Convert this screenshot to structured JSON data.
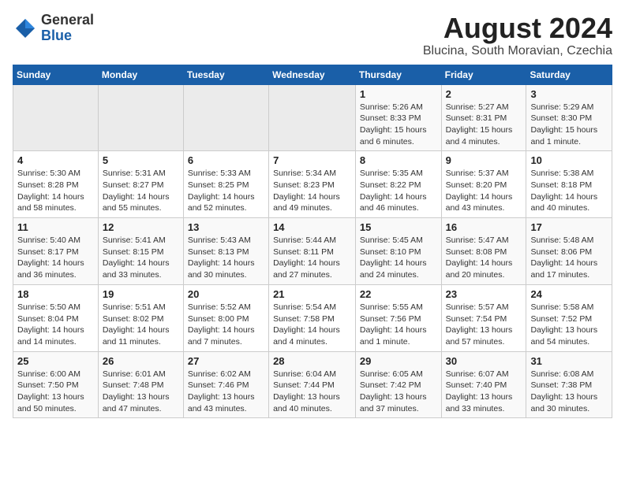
{
  "logo": {
    "line1": "General",
    "line2": "Blue"
  },
  "title": "August 2024",
  "subtitle": "Blucina, South Moravian, Czechia",
  "weekdays": [
    "Sunday",
    "Monday",
    "Tuesday",
    "Wednesday",
    "Thursday",
    "Friday",
    "Saturday"
  ],
  "weeks": [
    [
      {
        "day": "",
        "info": ""
      },
      {
        "day": "",
        "info": ""
      },
      {
        "day": "",
        "info": ""
      },
      {
        "day": "",
        "info": ""
      },
      {
        "day": "1",
        "info": "Sunrise: 5:26 AM\nSunset: 8:33 PM\nDaylight: 15 hours and 6 minutes."
      },
      {
        "day": "2",
        "info": "Sunrise: 5:27 AM\nSunset: 8:31 PM\nDaylight: 15 hours and 4 minutes."
      },
      {
        "day": "3",
        "info": "Sunrise: 5:29 AM\nSunset: 8:30 PM\nDaylight: 15 hours and 1 minute."
      }
    ],
    [
      {
        "day": "4",
        "info": "Sunrise: 5:30 AM\nSunset: 8:28 PM\nDaylight: 14 hours and 58 minutes."
      },
      {
        "day": "5",
        "info": "Sunrise: 5:31 AM\nSunset: 8:27 PM\nDaylight: 14 hours and 55 minutes."
      },
      {
        "day": "6",
        "info": "Sunrise: 5:33 AM\nSunset: 8:25 PM\nDaylight: 14 hours and 52 minutes."
      },
      {
        "day": "7",
        "info": "Sunrise: 5:34 AM\nSunset: 8:23 PM\nDaylight: 14 hours and 49 minutes."
      },
      {
        "day": "8",
        "info": "Sunrise: 5:35 AM\nSunset: 8:22 PM\nDaylight: 14 hours and 46 minutes."
      },
      {
        "day": "9",
        "info": "Sunrise: 5:37 AM\nSunset: 8:20 PM\nDaylight: 14 hours and 43 minutes."
      },
      {
        "day": "10",
        "info": "Sunrise: 5:38 AM\nSunset: 8:18 PM\nDaylight: 14 hours and 40 minutes."
      }
    ],
    [
      {
        "day": "11",
        "info": "Sunrise: 5:40 AM\nSunset: 8:17 PM\nDaylight: 14 hours and 36 minutes."
      },
      {
        "day": "12",
        "info": "Sunrise: 5:41 AM\nSunset: 8:15 PM\nDaylight: 14 hours and 33 minutes."
      },
      {
        "day": "13",
        "info": "Sunrise: 5:43 AM\nSunset: 8:13 PM\nDaylight: 14 hours and 30 minutes."
      },
      {
        "day": "14",
        "info": "Sunrise: 5:44 AM\nSunset: 8:11 PM\nDaylight: 14 hours and 27 minutes."
      },
      {
        "day": "15",
        "info": "Sunrise: 5:45 AM\nSunset: 8:10 PM\nDaylight: 14 hours and 24 minutes."
      },
      {
        "day": "16",
        "info": "Sunrise: 5:47 AM\nSunset: 8:08 PM\nDaylight: 14 hours and 20 minutes."
      },
      {
        "day": "17",
        "info": "Sunrise: 5:48 AM\nSunset: 8:06 PM\nDaylight: 14 hours and 17 minutes."
      }
    ],
    [
      {
        "day": "18",
        "info": "Sunrise: 5:50 AM\nSunset: 8:04 PM\nDaylight: 14 hours and 14 minutes."
      },
      {
        "day": "19",
        "info": "Sunrise: 5:51 AM\nSunset: 8:02 PM\nDaylight: 14 hours and 11 minutes."
      },
      {
        "day": "20",
        "info": "Sunrise: 5:52 AM\nSunset: 8:00 PM\nDaylight: 14 hours and 7 minutes."
      },
      {
        "day": "21",
        "info": "Sunrise: 5:54 AM\nSunset: 7:58 PM\nDaylight: 14 hours and 4 minutes."
      },
      {
        "day": "22",
        "info": "Sunrise: 5:55 AM\nSunset: 7:56 PM\nDaylight: 14 hours and 1 minute."
      },
      {
        "day": "23",
        "info": "Sunrise: 5:57 AM\nSunset: 7:54 PM\nDaylight: 13 hours and 57 minutes."
      },
      {
        "day": "24",
        "info": "Sunrise: 5:58 AM\nSunset: 7:52 PM\nDaylight: 13 hours and 54 minutes."
      }
    ],
    [
      {
        "day": "25",
        "info": "Sunrise: 6:00 AM\nSunset: 7:50 PM\nDaylight: 13 hours and 50 minutes."
      },
      {
        "day": "26",
        "info": "Sunrise: 6:01 AM\nSunset: 7:48 PM\nDaylight: 13 hours and 47 minutes."
      },
      {
        "day": "27",
        "info": "Sunrise: 6:02 AM\nSunset: 7:46 PM\nDaylight: 13 hours and 43 minutes."
      },
      {
        "day": "28",
        "info": "Sunrise: 6:04 AM\nSunset: 7:44 PM\nDaylight: 13 hours and 40 minutes."
      },
      {
        "day": "29",
        "info": "Sunrise: 6:05 AM\nSunset: 7:42 PM\nDaylight: 13 hours and 37 minutes."
      },
      {
        "day": "30",
        "info": "Sunrise: 6:07 AM\nSunset: 7:40 PM\nDaylight: 13 hours and 33 minutes."
      },
      {
        "day": "31",
        "info": "Sunrise: 6:08 AM\nSunset: 7:38 PM\nDaylight: 13 hours and 30 minutes."
      }
    ]
  ]
}
